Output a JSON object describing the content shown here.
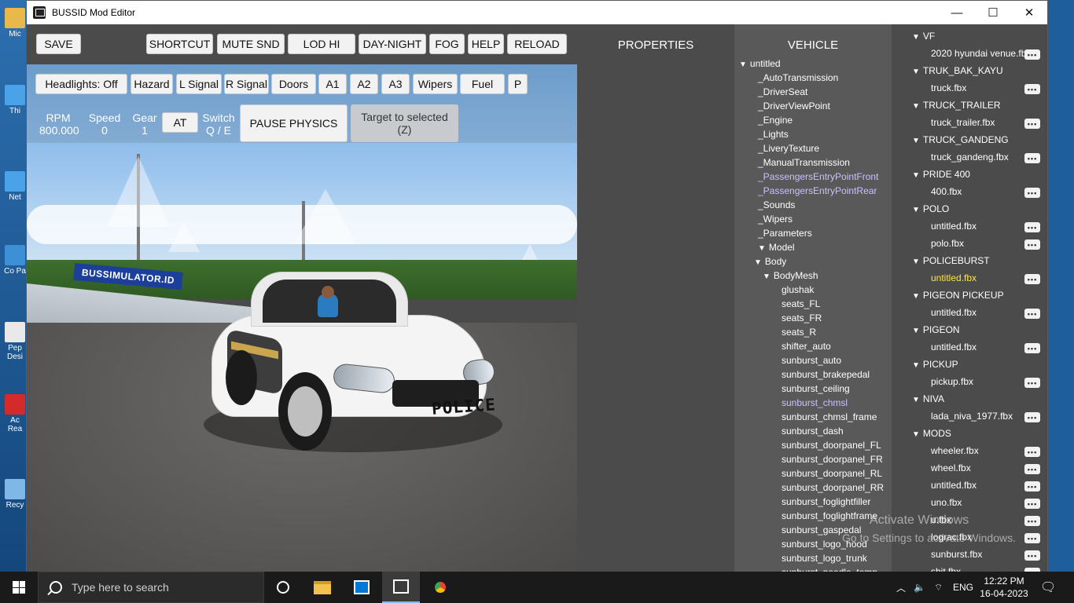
{
  "window": {
    "title": "BUSSID Mod Editor",
    "minimize": "—",
    "maximize": "☐",
    "close": "✕"
  },
  "desktop": {
    "icons": [
      "Mic",
      "Thi",
      "Net",
      "Co Pa",
      "Pep Desi",
      "Ac Rea",
      "Recy"
    ]
  },
  "toolbar": {
    "save": "SAVE",
    "shortcut": "SHORTCUT",
    "mute": "MUTE SND",
    "lod": "LOD HI",
    "daynight": "DAY-NIGHT",
    "fog": "FOG",
    "help": "HELP",
    "reload": "RELOAD"
  },
  "controls": {
    "headlights": "Headlights: Off",
    "hazard": "Hazard",
    "lsignal": "L Signal",
    "rsignal": "R Signal",
    "doors": "Doors",
    "a1": "A1",
    "a2": "A2",
    "a3": "A3",
    "wipers": "Wipers",
    "fuel": "Fuel",
    "p": "P"
  },
  "hud": {
    "rpm_label": "RPM",
    "rpm_value": "800.000",
    "speed_label": "Speed",
    "speed_value": "0",
    "gear_label": "Gear",
    "gear_value": "1",
    "at": "AT",
    "switch_label": "Switch",
    "switch_value": "Q / E",
    "pause": "PAUSE PHYSICS",
    "target_line1": "Target to selected",
    "target_line2": "(Z)"
  },
  "scene": {
    "banner": "BUSSIMULATOR.ID",
    "police": "POLICE"
  },
  "properties": {
    "title": "PROPERTIES"
  },
  "vehicle": {
    "title": "VEHICLE",
    "tree": [
      {
        "label": "untitled",
        "caret": "▼",
        "level": 0
      },
      {
        "label": "_AutoTransmission",
        "level": 1
      },
      {
        "label": "_DriverSeat",
        "level": 1
      },
      {
        "label": "_DriverViewPoint",
        "level": 1
      },
      {
        "label": "_Engine",
        "level": 1
      },
      {
        "label": "_Lights",
        "level": 1
      },
      {
        "label": "_LiveryTexture",
        "level": 1
      },
      {
        "label": "_ManualTransmission",
        "level": 1
      },
      {
        "label": "_PassengersEntryPointFront",
        "level": 1,
        "highlight": true
      },
      {
        "label": "_PassengersEntryPointRear",
        "level": 1,
        "highlight": true
      },
      {
        "label": "_Sounds",
        "level": 1
      },
      {
        "label": "_Wipers",
        "level": 1
      },
      {
        "label": "_Parameters",
        "level": 1
      },
      {
        "label": "Model",
        "caret": "▼",
        "level": 1
      },
      {
        "label": "Body",
        "caret": "▼",
        "level": 2
      },
      {
        "label": "BodyMesh",
        "caret": "▼",
        "level": 3
      },
      {
        "label": "glushak",
        "level": 4
      },
      {
        "label": "seats_FL",
        "level": 4
      },
      {
        "label": "seats_FR",
        "level": 4
      },
      {
        "label": "seats_R",
        "level": 4
      },
      {
        "label": "shifter_auto",
        "level": 4
      },
      {
        "label": "sunburst_auto",
        "level": 4
      },
      {
        "label": "sunburst_brakepedal",
        "level": 4
      },
      {
        "label": "sunburst_ceiling",
        "level": 4
      },
      {
        "label": "sunburst_chmsl",
        "level": 4,
        "highlight": true
      },
      {
        "label": "sunburst_chmsl_frame",
        "level": 4
      },
      {
        "label": "sunburst_dash",
        "level": 4
      },
      {
        "label": "sunburst_doorpanel_FL",
        "level": 4
      },
      {
        "label": "sunburst_doorpanel_FR",
        "level": 4
      },
      {
        "label": "sunburst_doorpanel_RL",
        "level": 4
      },
      {
        "label": "sunburst_doorpanel_RR",
        "level": 4
      },
      {
        "label": "sunburst_foglightfiller",
        "level": 4
      },
      {
        "label": "sunburst_foglightframe",
        "level": 4
      },
      {
        "label": "sunburst_gaspedal",
        "level": 4
      },
      {
        "label": "sunburst_logo_hood",
        "level": 4
      },
      {
        "label": "sunburst_logo_trunk",
        "level": 4
      },
      {
        "label": "sunburst_needle_temp",
        "level": 4
      }
    ]
  },
  "files": {
    "more": "•••",
    "rows": [
      {
        "type": "group",
        "label": "VF"
      },
      {
        "type": "file",
        "label": "2020 hyundai venue.fb"
      },
      {
        "type": "group",
        "label": "TRUK_BAK_KAYU"
      },
      {
        "type": "file",
        "label": "truck.fbx"
      },
      {
        "type": "group",
        "label": "TRUCK_TRAILER"
      },
      {
        "type": "file",
        "label": "truck_trailer.fbx"
      },
      {
        "type": "group",
        "label": "TRUCK_GANDENG"
      },
      {
        "type": "file",
        "label": "truck_gandeng.fbx"
      },
      {
        "type": "group",
        "label": "PRIDE 400"
      },
      {
        "type": "file",
        "label": "400.fbx"
      },
      {
        "type": "group",
        "label": "POLO"
      },
      {
        "type": "file",
        "label": "untitled.fbx"
      },
      {
        "type": "file",
        "label": "polo.fbx"
      },
      {
        "type": "group",
        "label": "POLICEBURST"
      },
      {
        "type": "file",
        "label": "untitled.fbx",
        "selected": true
      },
      {
        "type": "group",
        "label": "PIGEON PICKEUP"
      },
      {
        "type": "file",
        "label": "untitled.fbx"
      },
      {
        "type": "group",
        "label": "PIGEON"
      },
      {
        "type": "file",
        "label": "untitled.fbx"
      },
      {
        "type": "group",
        "label": "PICKUP"
      },
      {
        "type": "file",
        "label": "pickup.fbx"
      },
      {
        "type": "group",
        "label": "NIVA"
      },
      {
        "type": "file",
        "label": "lada_niva_1977.fbx"
      },
      {
        "type": "group",
        "label": "MODS"
      },
      {
        "type": "file",
        "label": "wheeler.fbx"
      },
      {
        "type": "file",
        "label": "wheel.fbx"
      },
      {
        "type": "file",
        "label": "untitled.fbx"
      },
      {
        "type": "file",
        "label": "uno.fbx"
      },
      {
        "type": "file",
        "label": "u.fbx"
      },
      {
        "type": "file",
        "label": "lograc.fbx"
      },
      {
        "type": "file",
        "label": "sunburst.fbx"
      },
      {
        "type": "file",
        "label": "shit.fbx"
      }
    ]
  },
  "watermark": {
    "line1": "Activate Windows",
    "line2": "Go to Settings to activate Windows."
  },
  "taskbar": {
    "search_placeholder": "Type here to search",
    "lang": "ENG",
    "time": "12:22 PM",
    "date": "16-04-2023"
  },
  "colors": {
    "panel_dark": "#4b4b4b",
    "panel_mid": "#595959",
    "selected_file": "#ffe24a",
    "highlight_node": "#c9c1ff"
  }
}
